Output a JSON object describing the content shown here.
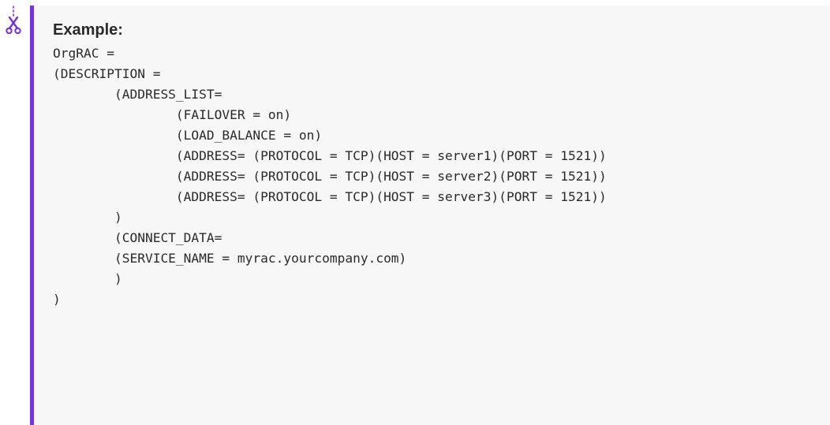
{
  "note": {
    "icon": "scissors-icon",
    "title": "Example:",
    "code_lines": [
      "OrgRAC =",
      "(DESCRIPTION =",
      "        (ADDRESS_LIST=",
      "                (FAILOVER = on)",
      "                (LOAD_BALANCE = on)",
      "                (ADDRESS= (PROTOCOL = TCP)(HOST = server1)(PORT = 1521))",
      "                (ADDRESS= (PROTOCOL = TCP)(HOST = server2)(PORT = 1521))",
      "                (ADDRESS= (PROTOCOL = TCP)(HOST = server3)(PORT = 1521))",
      "        )",
      "        (CONNECT_DATA=",
      "        (SERVICE_NAME = myrac.yourcompany.com)",
      "        )",
      ")"
    ]
  },
  "colors": {
    "accent": "#7630ea",
    "panel_background": "#f7f7f7",
    "text": "#2a2a2a"
  }
}
